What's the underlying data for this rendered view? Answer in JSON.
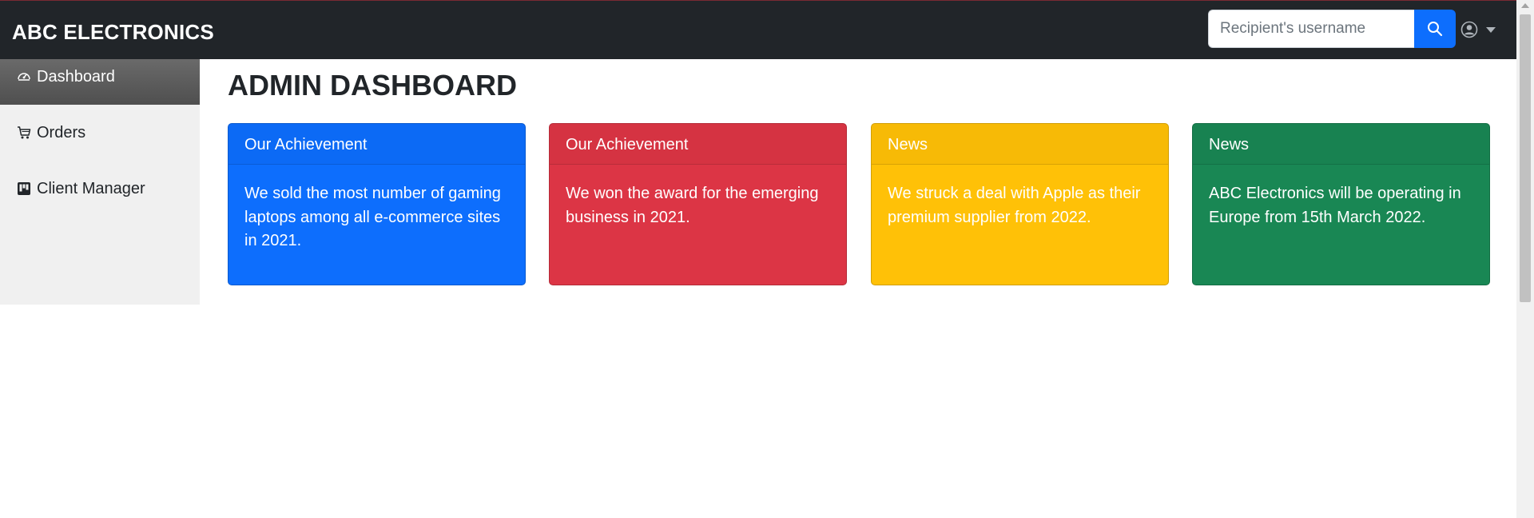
{
  "brand": "ABC ELECTRONICS",
  "search": {
    "placeholder": "Recipient's username",
    "value": ""
  },
  "sidebar": {
    "items": [
      {
        "label": "Dashboard",
        "icon": "speedometer-icon",
        "active": true
      },
      {
        "label": "Orders",
        "icon": "cart-icon"
      },
      {
        "label": "Client Manager",
        "icon": "kanban-icon"
      }
    ]
  },
  "page_title": "ADMIN DASHBOARD",
  "cards": [
    {
      "header": "Our Achievement",
      "body": "We sold the most number of gaming laptops among all e-commerce sites in 2021.",
      "color": "#0d6efd"
    },
    {
      "header": "Our Achievement",
      "body": "We won the award for the emerging business in 2021.",
      "color": "#dc3545"
    },
    {
      "header": "News",
      "body": "We struck a deal with Apple as their premium supplier from 2022.",
      "color": "#ffc107"
    },
    {
      "header": "News",
      "body": "ABC Electronics will be operating in Europe from 15th March 2022.",
      "color": "#198754"
    }
  ],
  "colors": {
    "navbar": "#212529",
    "sidebar": "#f0f0f0",
    "accent": "#0d6efd"
  }
}
